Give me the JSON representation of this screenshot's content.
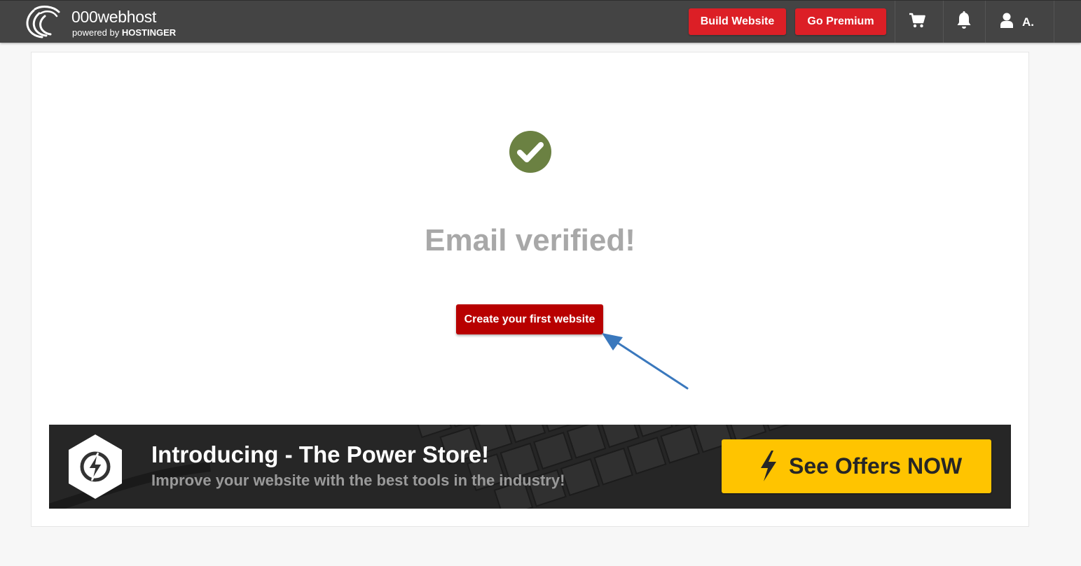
{
  "header": {
    "brand_name": "000webhost",
    "brand_sub_prefix": "powered by",
    "brand_sub_name": "HOSTINGER",
    "build_label": "Build Website",
    "premium_label": "Go Premium",
    "cart_icon": "cart-icon",
    "bell_icon": "bell-icon",
    "user_icon": "user-icon",
    "user_initial": "A."
  },
  "main": {
    "status_icon": "check-circle-icon",
    "title": "Email verified!",
    "cta_label": "Create your first website"
  },
  "banner": {
    "title": "Introducing - The Power Store!",
    "subtitle": "Improve your website with the best tools in the industry!",
    "offers_label": "See Offers NOW",
    "icon": "lightning-hexagon-icon"
  },
  "colors": {
    "topbar": "#444444",
    "header_button": "#dc1f26",
    "cta": "#b80000",
    "check": "#6b8142",
    "offers": "#ffc400",
    "arrow": "#3a78bd"
  }
}
